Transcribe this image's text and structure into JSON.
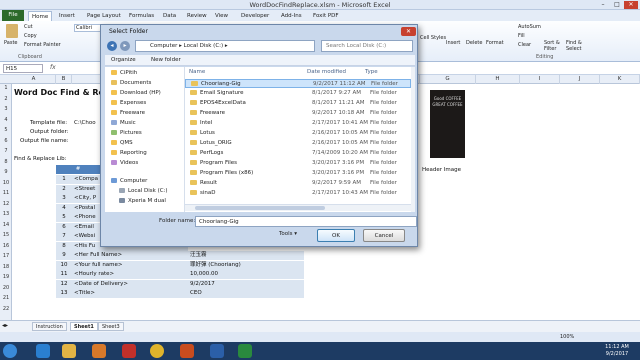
{
  "window": {
    "title": "WordDocFindReplace.xlsm - Microsoft Excel"
  },
  "ribbon": {
    "file_tab": "File",
    "tabs": [
      "Home",
      "Insert",
      "Page Layout",
      "Formulas",
      "Data",
      "Review",
      "View",
      "Developer",
      "Add-Ins",
      "Foxit PDF"
    ],
    "active_tab": "Home",
    "paste": "Paste",
    "cut": "Cut",
    "copy": "Copy",
    "format_painter": "Format Painter",
    "font_name": "Calibri",
    "clipboard_group": "Clipboard",
    "cell_styles": "Cell Styles",
    "insert": "Insert",
    "delete": "Delete",
    "format": "Format",
    "autosum": "AutoSum",
    "fill": "Fill",
    "clear": "Clear",
    "sort_filter": "Sort & Filter",
    "find_select": "Find & Select",
    "editing_group": "Editing"
  },
  "formula_bar": {
    "name_box": "H15",
    "fx": "fx"
  },
  "columns": [
    "A",
    "B",
    "C",
    "D",
    "E",
    "F",
    "G",
    "H",
    "I",
    "J",
    "K"
  ],
  "rows": [
    "1",
    "2",
    "3",
    "4",
    "5",
    "6",
    "7",
    "8",
    "9",
    "10",
    "11",
    "12",
    "13",
    "14",
    "15",
    "16",
    "17",
    "18",
    "19",
    "20",
    "21",
    "22"
  ],
  "sheet": {
    "heading": "Word Doc Find & Re",
    "template_label": "Template file:",
    "template_value": "C:\\Choo",
    "output_folder_label": "Output folder:",
    "output_name_label": "Output file name:",
    "lib_label": "Find & Replace Lib:",
    "num_header": "#",
    "items": [
      {
        "n": "1",
        "tag": "<Compa"
      },
      {
        "n": "2",
        "tag": "<Street"
      },
      {
        "n": "3",
        "tag": "<City, P"
      },
      {
        "n": "4",
        "tag": "<Postal"
      },
      {
        "n": "5",
        "tag": "<Phone"
      },
      {
        "n": "6",
        "tag": "<Email"
      },
      {
        "n": "7",
        "tag": "<Websi"
      },
      {
        "n": "8",
        "tag": "<His Fu"
      },
      {
        "n": "9",
        "tag": "<Her Full Name>",
        "value": "汪玉霧"
      },
      {
        "n": "10",
        "tag": "<Your full name>",
        "value": "罪好彈 (Chooriang)"
      },
      {
        "n": "11",
        "tag": "<Hourly rate>",
        "value": "10,000.00"
      },
      {
        "n": "12",
        "tag": "<Date of Delivery>",
        "value": "9/2/2017"
      },
      {
        "n": "13",
        "tag": "<Title>",
        "value": "CEO"
      }
    ],
    "header_image_label": "Header Image",
    "header_image_text": "Good COFFEE GREAT COFFEE"
  },
  "sheet_tabs": [
    "Instruction",
    "Sheet1",
    "Sheet3"
  ],
  "active_sheet": "Sheet1",
  "status": {
    "zoom": "100%"
  },
  "taskbar": {
    "time": "11:12 AM",
    "date": "9/2/2017"
  },
  "dialog": {
    "title": "Select Folder",
    "breadcrumb": [
      "Computer",
      "Local Disk (C:)"
    ],
    "search_placeholder": "Search Local Disk (C:)",
    "organize": "Organize",
    "new_folder": "New folder",
    "nav_items": [
      "CiPitih",
      "Documents",
      "Download (HP)",
      "Expenses",
      "Freeware",
      "Music",
      "Pictures",
      "QMS",
      "Reporting",
      "Videos",
      "Computer",
      "Local Disk (C:)",
      "Xperia M dual"
    ],
    "columns": {
      "name": "Name",
      "date": "Date modified",
      "type": "Type"
    },
    "files": [
      {
        "name": "Chooriang-Gig",
        "date": "9/2/2017 11:12 AM",
        "type": "File folder",
        "selected": true
      },
      {
        "name": "Email Signature",
        "date": "8/1/2017 9:27 AM",
        "type": "File folder"
      },
      {
        "name": "EPOS4ExcelData",
        "date": "8/1/2017 11:21 AM",
        "type": "File folder"
      },
      {
        "name": "Freeware",
        "date": "9/2/2017 10:18 AM",
        "type": "File folder"
      },
      {
        "name": "Intel",
        "date": "2/17/2017 10:41 AM",
        "type": "File folder"
      },
      {
        "name": "Lotus",
        "date": "2/16/2017 10:05 AM",
        "type": "File folder"
      },
      {
        "name": "Lotus_ORIG",
        "date": "2/16/2017 10:05 AM",
        "type": "File folder"
      },
      {
        "name": "PerfLogs",
        "date": "7/14/2009 10:20 AM",
        "type": "File folder"
      },
      {
        "name": "Program Files",
        "date": "3/20/2017 3:16 PM",
        "type": "File folder"
      },
      {
        "name": "Program Files (x86)",
        "date": "3/20/2017 3:16 PM",
        "type": "File folder"
      },
      {
        "name": "Result",
        "date": "9/2/2017 9:59 AM",
        "type": "File folder"
      },
      {
        "name": "sinaD",
        "date": "2/17/2017 10:43 AM",
        "type": "File folder"
      }
    ],
    "folder_name_label": "Folder name:",
    "folder_name_value": "Chooriang-Gig",
    "tools": "Tools",
    "ok": "OK",
    "cancel": "Cancel"
  }
}
